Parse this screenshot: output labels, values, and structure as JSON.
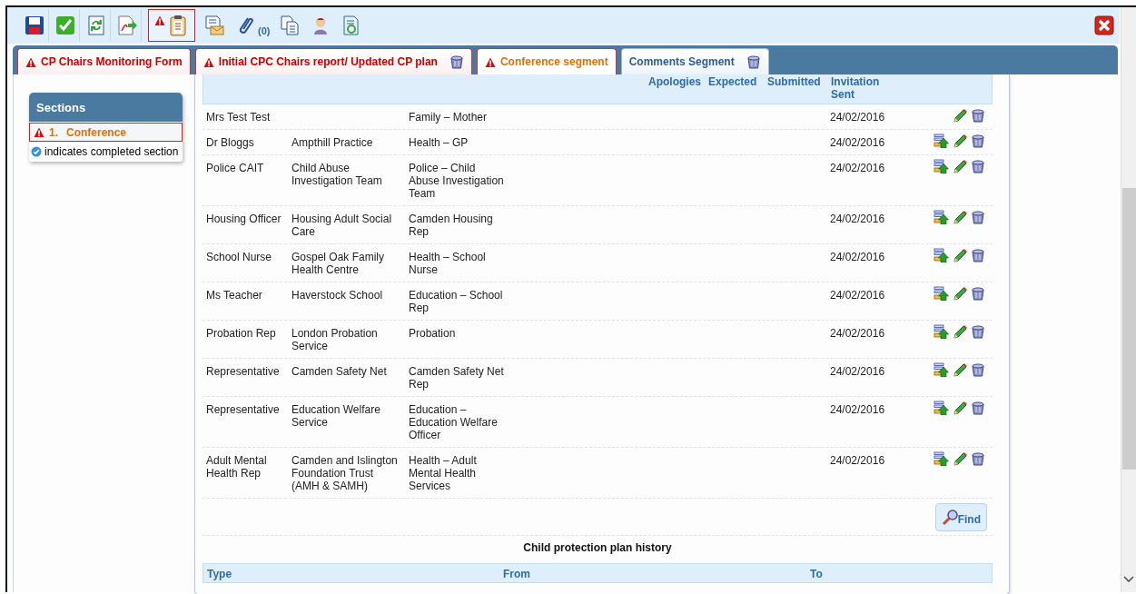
{
  "toolbar": {
    "items": [
      {
        "kind": "save",
        "selected": false,
        "warning": false
      },
      {
        "kind": "approve",
        "selected": false,
        "warning": false
      },
      {
        "kind": "refresh",
        "selected": false,
        "warning": false
      },
      {
        "kind": "pdf-export",
        "selected": false,
        "warning": false
      },
      {
        "kind": "form",
        "selected": true,
        "warning": true
      },
      {
        "kind": "letter",
        "selected": false,
        "warning": false
      },
      {
        "kind": "attachment",
        "selected": false,
        "warning": false,
        "count": "(0)"
      },
      {
        "kind": "copy",
        "selected": false,
        "warning": false
      },
      {
        "kind": "person",
        "selected": false,
        "warning": false
      },
      {
        "kind": "document-refresh",
        "selected": false,
        "warning": false
      }
    ]
  },
  "tabs": [
    {
      "label": "CP Chairs Monitoring Form",
      "warning": true,
      "deletable": false,
      "selected": false
    },
    {
      "label": "Initial CPC Chairs report/ Updated CP plan",
      "warning": true,
      "deletable": true,
      "selected": false
    },
    {
      "label": "Conference segment",
      "warning": true,
      "deletable": false,
      "selected": true
    },
    {
      "label": "Comments Segment",
      "warning": false,
      "deletable": true,
      "selected": false
    }
  ],
  "sections": {
    "title": "Sections",
    "items": [
      {
        "number": "1.",
        "label": "Conference",
        "warning": true,
        "selected": true
      }
    ],
    "legend": "indicates completed section"
  },
  "attendees": {
    "columns": [
      "Apologies",
      "Expected",
      "Submitted",
      "Invitation Sent"
    ],
    "rows": [
      {
        "name": "Mrs Test Test",
        "organisation": "",
        "role": "Family – Mother",
        "invitation_sent": "24/02/2016",
        "can_promote": false
      },
      {
        "name": "Dr Bloggs",
        "organisation": "Ampthill Practice",
        "role": "Health – GP",
        "invitation_sent": "24/02/2016",
        "can_promote": true
      },
      {
        "name": "Police CAIT",
        "organisation": "Child Abuse Investigation Team",
        "role": "Police – Child Abuse Investigation Team",
        "invitation_sent": "24/02/2016",
        "can_promote": true
      },
      {
        "name": "Housing Officer",
        "organisation": "Housing Adult Social Care",
        "role": "Camden Housing Rep",
        "invitation_sent": "24/02/2016",
        "can_promote": true
      },
      {
        "name": "School Nurse",
        "organisation": "Gospel Oak Family Health Centre",
        "role": "Health – School Nurse",
        "invitation_sent": "24/02/2016",
        "can_promote": true
      },
      {
        "name": "Ms Teacher",
        "organisation": "Haverstock School",
        "role": "Education – School Rep",
        "invitation_sent": "24/02/2016",
        "can_promote": true
      },
      {
        "name": "Probation Rep",
        "organisation": "London Probation Service",
        "role": "Probation",
        "invitation_sent": "24/02/2016",
        "can_promote": true
      },
      {
        "name": "Representative",
        "organisation": "Camden Safety Net",
        "role": "Camden Safety Net Rep",
        "invitation_sent": "24/02/2016",
        "can_promote": true
      },
      {
        "name": "Representative",
        "organisation": "Education Welfare Service",
        "role": "Education – Education Welfare Officer",
        "invitation_sent": "24/02/2016",
        "can_promote": true
      },
      {
        "name": "Adult Mental Health Rep",
        "organisation": "Camden and Islington Foundation Trust (AMH & SAMH)",
        "role": "Health – Adult Mental Health Services",
        "invitation_sent": "24/02/2016",
        "can_promote": true
      }
    ],
    "find_button": "Find"
  },
  "history": {
    "title": "Child protection plan history",
    "columns": [
      "Type",
      "From",
      "To"
    ]
  }
}
